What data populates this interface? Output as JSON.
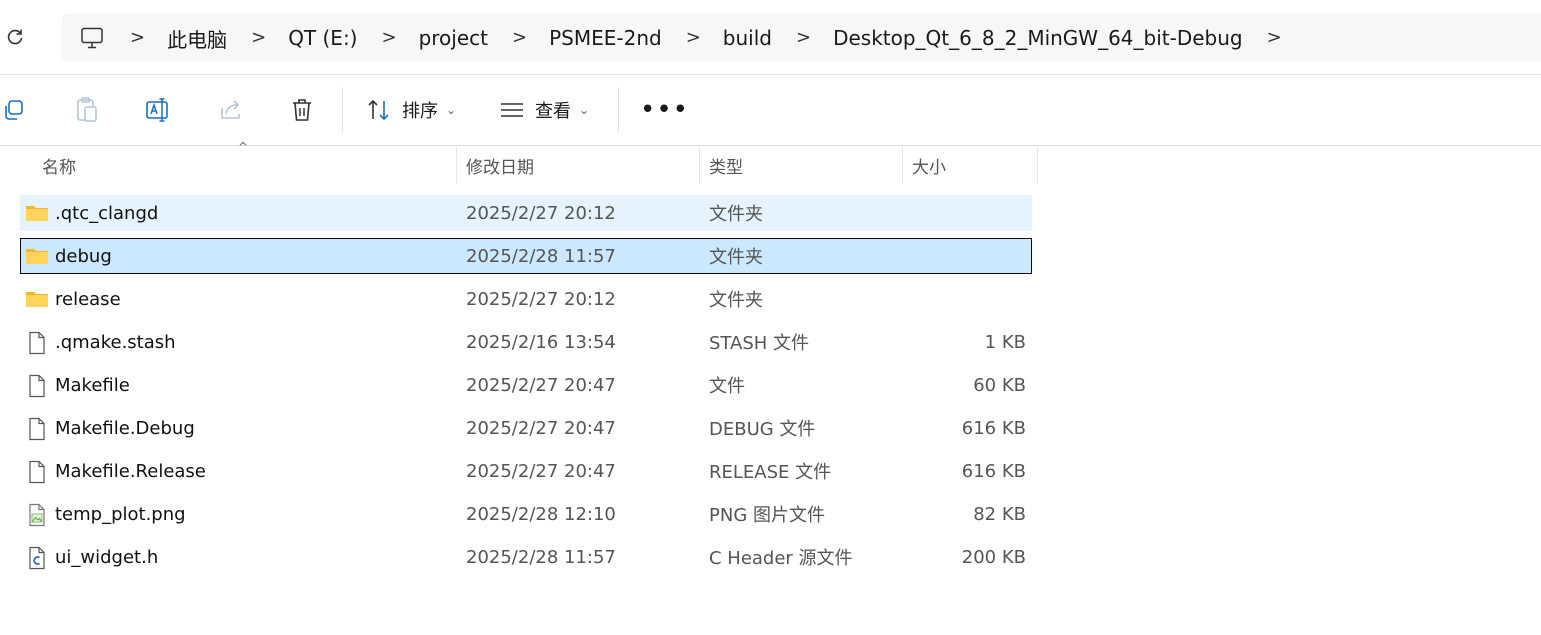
{
  "breadcrumb": {
    "items": [
      "此电脑",
      "QT (E:)",
      "project",
      "PSMEE-2nd",
      "build",
      "Desktop_Qt_6_8_2_MinGW_64_bit-Debug"
    ]
  },
  "toolbar": {
    "sort_label": "排序",
    "view_label": "查看",
    "more_label": "•••"
  },
  "columns": {
    "name": "名称",
    "date": "修改日期",
    "type": "类型",
    "size": "大小"
  },
  "files": [
    {
      "name": ".qtc_clangd",
      "date": "2025/2/27 20:12",
      "type": "文件夹",
      "size": "",
      "icon": "folder-icon"
    },
    {
      "name": "debug",
      "date": "2025/2/28 11:57",
      "type": "文件夹",
      "size": "",
      "icon": "folder-icon"
    },
    {
      "name": "release",
      "date": "2025/2/27 20:12",
      "type": "文件夹",
      "size": "",
      "icon": "folder-icon"
    },
    {
      "name": ".qmake.stash",
      "date": "2025/2/16 13:54",
      "type": "STASH 文件",
      "size": "1 KB",
      "icon": "file-icon"
    },
    {
      "name": "Makefile",
      "date": "2025/2/27 20:47",
      "type": "文件",
      "size": "60 KB",
      "icon": "file-icon"
    },
    {
      "name": "Makefile.Debug",
      "date": "2025/2/27 20:47",
      "type": "DEBUG 文件",
      "size": "616 KB",
      "icon": "file-icon"
    },
    {
      "name": "Makefile.Release",
      "date": "2025/2/27 20:47",
      "type": "RELEASE 文件",
      "size": "616 KB",
      "icon": "file-icon"
    },
    {
      "name": "temp_plot.png",
      "date": "2025/2/28 12:10",
      "type": "PNG 图片文件",
      "size": "82 KB",
      "icon": "image-file-icon"
    },
    {
      "name": "ui_widget.h",
      "date": "2025/2/28 11:57",
      "type": "C Header 源文件",
      "size": "200 KB",
      "icon": "c-header-file-icon"
    }
  ],
  "colors": {
    "hover_row": "#e5f3ff",
    "selected_row": "#cce8ff",
    "folder": "#f8c533"
  }
}
